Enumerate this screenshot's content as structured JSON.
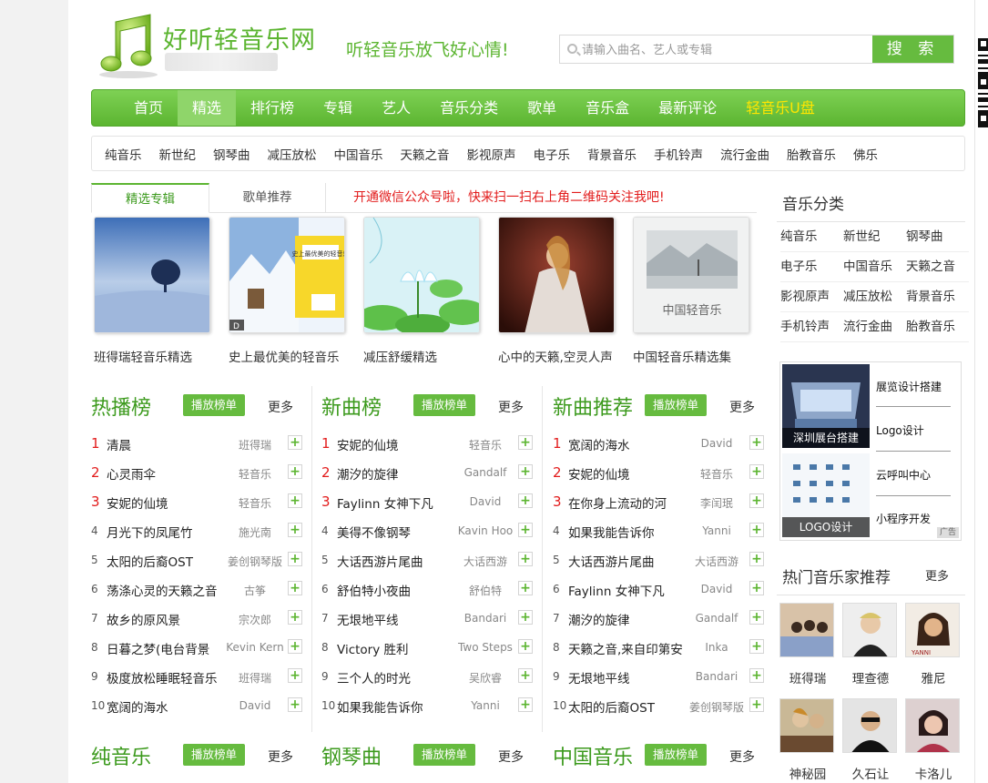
{
  "header": {
    "site_name": "好听轻音乐网",
    "slogan": "听轻音乐放飞好心情!",
    "search": {
      "placeholder": "请输入曲名、艺人或专辑",
      "button_label": "搜 索"
    }
  },
  "main_nav": [
    "首页",
    "精选",
    "排行榜",
    "专辑",
    "艺人",
    "音乐分类",
    "歌单",
    "音乐盒",
    "最新评论",
    "轻音乐U盘"
  ],
  "main_nav_active": "精选",
  "sub_nav": [
    "纯音乐",
    "新世纪",
    "钢琴曲",
    "减压放松",
    "中国音乐",
    "天籁之音",
    "影视原声",
    "电子乐",
    "背景音乐",
    "手机铃声",
    "流行金曲",
    "胎教音乐",
    "佛乐"
  ],
  "tabs": {
    "featured_albums": "精选专辑",
    "playlist_recs": "歌单推荐",
    "notice": "开通微信公众号啦，快来扫一扫右上角二维码关注我吧!"
  },
  "albums": [
    "班得瑞轻音乐精选",
    "史上最优美的轻音乐",
    "减压舒缓精选",
    "心中的天籁,空灵人声",
    "中国轻音乐精选集"
  ],
  "album_cover_text": {
    "badge": "D",
    "album2_title": "史上最優美的輕音樂",
    "album5_title": "中国轻音乐"
  },
  "charts": [
    {
      "title": "热播榜",
      "play_label": "播放榜单",
      "more_label": "更多",
      "songs": [
        {
          "n": "1",
          "title": "清晨",
          "artist": "班得瑞"
        },
        {
          "n": "2",
          "title": "心灵雨伞",
          "artist": "轻音乐"
        },
        {
          "n": "3",
          "title": "安妮的仙境",
          "artist": "轻音乐"
        },
        {
          "n": "4",
          "title": "月光下的凤尾竹",
          "artist": "施光南"
        },
        {
          "n": "5",
          "title": "太阳的后裔OST",
          "artist": "姜创钢琴版"
        },
        {
          "n": "6",
          "title": "荡涤心灵的天籁之音",
          "artist": "古筝"
        },
        {
          "n": "7",
          "title": "故乡的原风景",
          "artist": "宗次郎"
        },
        {
          "n": "8",
          "title": "日暮之梦(电台背景",
          "artist": "Kevin Kern"
        },
        {
          "n": "9",
          "title": "极度放松睡眠轻音乐",
          "artist": "班得瑞"
        },
        {
          "n": "10",
          "title": "宽阔的海水",
          "artist": "David"
        }
      ]
    },
    {
      "title": "新曲榜",
      "play_label": "播放榜单",
      "more_label": "更多",
      "songs": [
        {
          "n": "1",
          "title": "安妮的仙境",
          "artist": "轻音乐"
        },
        {
          "n": "2",
          "title": "潮汐的旋律",
          "artist": "Gandalf"
        },
        {
          "n": "3",
          "title": "Faylinn 女神下凡",
          "artist": "David"
        },
        {
          "n": "4",
          "title": "美得不像钢琴",
          "artist": "Kavin Hoo"
        },
        {
          "n": "5",
          "title": "大话西游片尾曲",
          "artist": "大话西游"
        },
        {
          "n": "6",
          "title": "舒伯特小夜曲",
          "artist": "舒伯特"
        },
        {
          "n": "7",
          "title": "无垠地平线",
          "artist": "Bandari"
        },
        {
          "n": "8",
          "title": "Victory 胜利",
          "artist": "Two Steps"
        },
        {
          "n": "9",
          "title": "三个人的时光",
          "artist": "吴欣睿"
        },
        {
          "n": "10",
          "title": "如果我能告诉你",
          "artist": "Yanni"
        }
      ]
    },
    {
      "title": "新曲推荐",
      "play_label": "播放榜单",
      "more_label": "更多",
      "songs": [
        {
          "n": "1",
          "title": "宽阔的海水",
          "artist": "David"
        },
        {
          "n": "2",
          "title": "安妮的仙境",
          "artist": "轻音乐"
        },
        {
          "n": "3",
          "title": "在你身上流动的河",
          "artist": "李闰珉"
        },
        {
          "n": "4",
          "title": "如果我能告诉你",
          "artist": "Yanni"
        },
        {
          "n": "5",
          "title": "大话西游片尾曲",
          "artist": "大话西游"
        },
        {
          "n": "6",
          "title": "Faylinn 女神下凡",
          "artist": "David"
        },
        {
          "n": "7",
          "title": "潮汐的旋律",
          "artist": "Gandalf"
        },
        {
          "n": "8",
          "title": "天籁之音,来自印第安",
          "artist": "Inka"
        },
        {
          "n": "9",
          "title": "无垠地平线",
          "artist": "Bandari"
        },
        {
          "n": "10",
          "title": "太阳的后裔OST",
          "artist": "姜创钢琴版"
        }
      ]
    }
  ],
  "bottom_sections": [
    {
      "title": "纯音乐",
      "play_label": "播放榜单",
      "more_label": "更多"
    },
    {
      "title": "钢琴曲",
      "play_label": "播放榜单",
      "more_label": "更多"
    },
    {
      "title": "中国音乐",
      "play_label": "播放榜单",
      "more_label": "更多"
    }
  ],
  "sidebar": {
    "genres_title": "音乐分类",
    "genres": [
      "纯音乐",
      "新世纪",
      "钢琴曲",
      "电子乐",
      "中国音乐",
      "天籁之音",
      "影视原声",
      "减压放松",
      "背景音乐",
      "手机铃声",
      "流行金曲",
      "胎教音乐"
    ],
    "ad": {
      "img1_label": "深圳展台搭建",
      "img2_label": "LOGO设计",
      "links": [
        "展览设计搭建",
        "Logo设计",
        "云呼叫中心",
        "小程序开发"
      ],
      "badge": "广告"
    },
    "artists_title": "热门音乐家推荐",
    "artists_more": "更多",
    "artists": [
      "班得瑞",
      "理查德",
      "雅尼",
      "神秘园",
      "久石让",
      "卡洛儿"
    ],
    "artist_photo_text": {
      "yanni": "YANNI"
    }
  },
  "colors": {
    "brand_green": "#5cb531",
    "accent_red": "#e21b1b",
    "nav_highlight": "#ffe600"
  }
}
